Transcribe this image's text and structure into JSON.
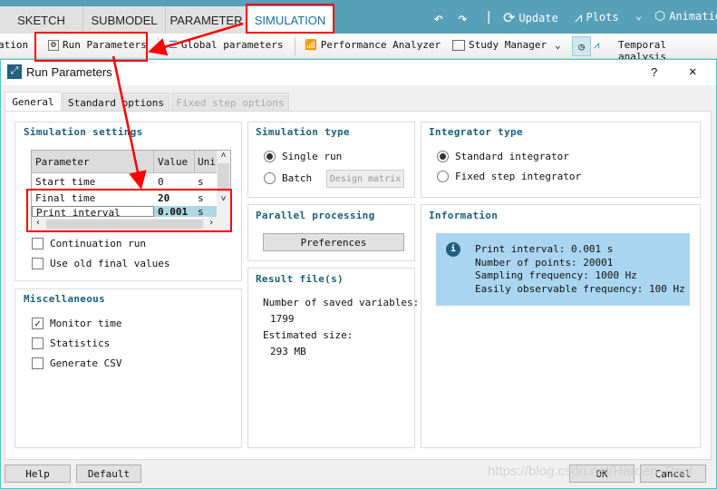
{
  "ribbon": {
    "tabs": [
      "SKETCH",
      "SUBMODEL",
      "PARAMETER",
      "SIMULATION"
    ],
    "active_tab": "SIMULATION",
    "update_label": "Update",
    "plots_label": "Plots",
    "animation_label": "Animation"
  },
  "toolbar": {
    "items": [
      "ation",
      "Run Parameters",
      "Global parameters",
      "Performance Analyzer",
      "Study Manager",
      "Temporal analysis"
    ]
  },
  "dialog": {
    "title": "Run Parameters",
    "help": "?",
    "close": "✕",
    "tabs": [
      "General",
      "Standard options",
      "Fixed step options"
    ],
    "sim_settings": {
      "title": "Simulation settings",
      "headers": [
        "Parameter",
        "Value",
        "Unit"
      ],
      "rows": [
        [
          "Start time",
          "0",
          "s"
        ],
        [
          "Final time",
          "20",
          "s"
        ],
        [
          "Print interval",
          "0.001",
          "s"
        ]
      ],
      "continuation": "Continuation run",
      "use_old": "Use old final values"
    },
    "misc": {
      "title": "Miscellaneous",
      "monitor": "Monitor time",
      "statistics": "Statistics",
      "csv": "Generate CSV",
      "monitor_checked": true
    },
    "sim_type": {
      "title": "Simulation type",
      "single": "Single run",
      "batch": "Batch",
      "design": "Design matrix",
      "selected": "Single run"
    },
    "parallel": {
      "title": "Parallel processing",
      "prefs": "Preferences"
    },
    "results": {
      "title": "Result file(s)",
      "saved_label": "Number of saved variables:",
      "saved_value": "1799",
      "size_label": "Estimated size:",
      "size_value": "293 MB"
    },
    "integrator": {
      "title": "Integrator type",
      "standard": "Standard integrator",
      "fixed": "Fixed step integrator",
      "selected": "Standard integrator"
    },
    "info": {
      "title": "Information",
      "lines": [
        "Print interval: 0.001 s",
        "Number of points: 20001",
        "Sampling frequency: 1000 Hz",
        "Easily observable frequency: 100 Hz"
      ]
    },
    "buttons": {
      "help": "Help",
      "default": "Default",
      "ok": "OK",
      "cancel": "Cancel"
    }
  },
  "watermark": "https://blog.csdn.net/Harden_Paul",
  "colors": {
    "ribbon": "#57a0b9",
    "accent": "#1a5f7a",
    "info_bg": "#aad5f0",
    "annotation": "#ff0000"
  }
}
